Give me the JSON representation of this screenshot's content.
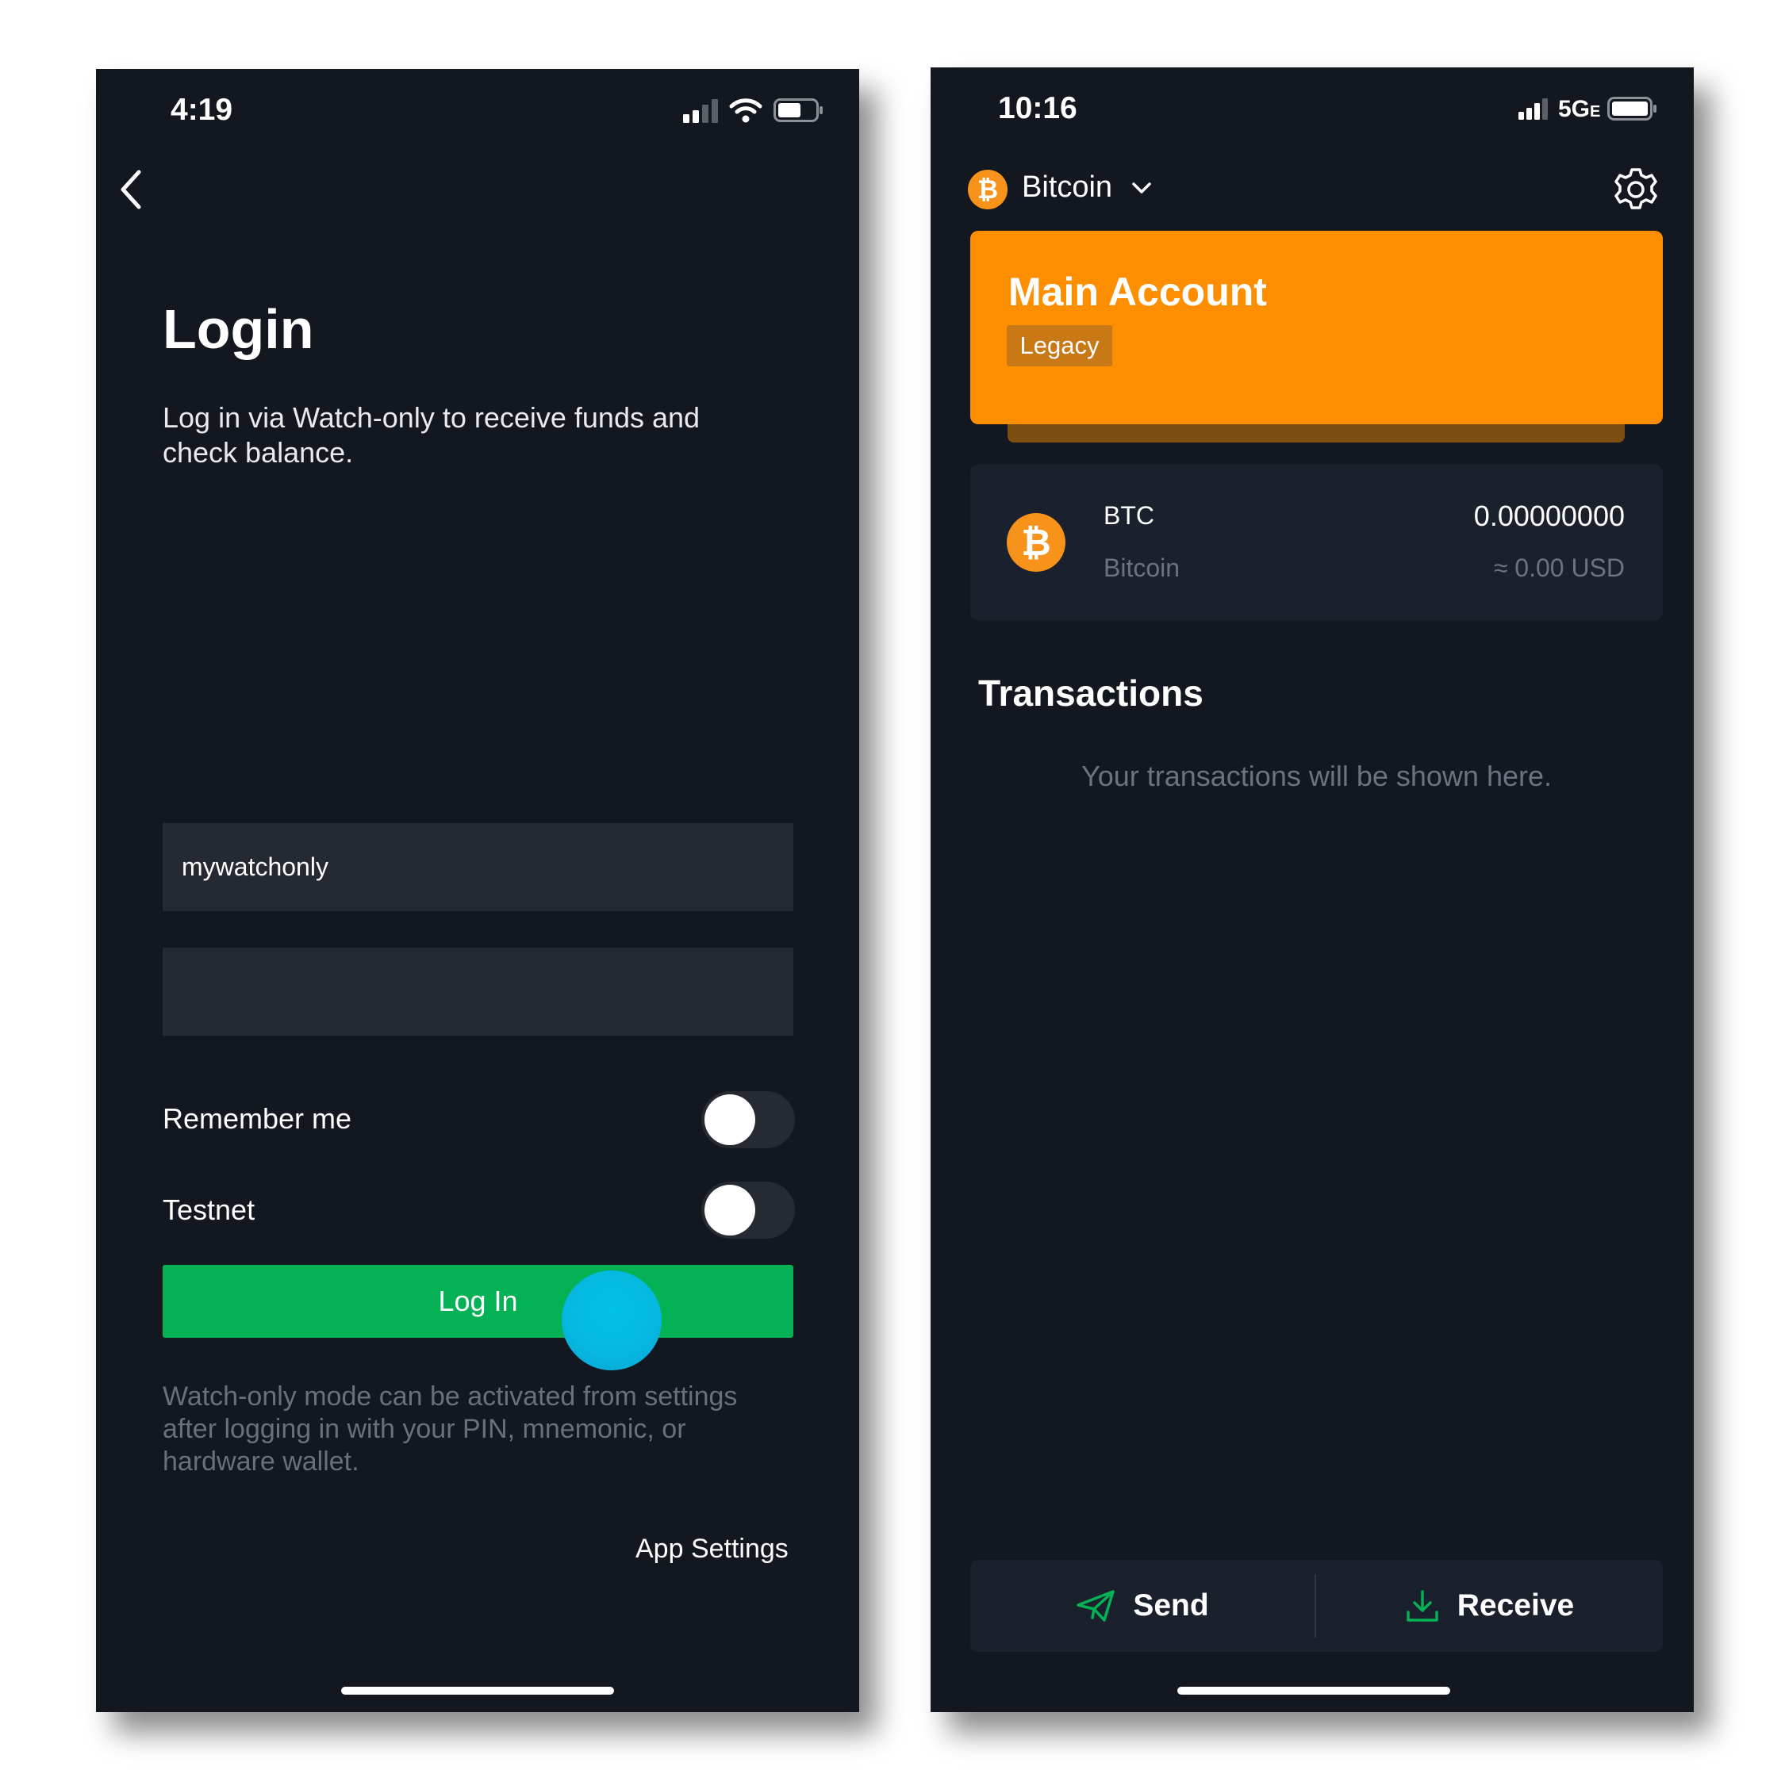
{
  "left_screen": {
    "status_bar": {
      "time": "4:19"
    },
    "title": "Login",
    "subtitle": "Log in via Watch-only to receive funds and check balance.",
    "username_input": {
      "value": "mywatchonly",
      "placeholder": ""
    },
    "second_input": {
      "value": "",
      "placeholder": ""
    },
    "toggles": [
      {
        "label": "Remember me",
        "on": false
      },
      {
        "label": "Testnet",
        "on": false
      }
    ],
    "login_button_label": "Log In",
    "hint": "Watch-only mode can be activated from settings after logging in with your PIN, mnemonic, or hardware wallet.",
    "app_settings_label": "App Settings"
  },
  "right_screen": {
    "status_bar": {
      "time": "10:16",
      "network": "5G",
      "network_suffix": "E"
    },
    "coin_selector": {
      "name": "Bitcoin",
      "icon": "bitcoin-icon"
    },
    "account_card": {
      "title": "Main Account",
      "badge": "Legacy",
      "color": "#fd8e00"
    },
    "asset": {
      "symbol": "BTC",
      "name": "Bitcoin",
      "balance": "0.00000000",
      "fiat": "≈ 0.00 USD"
    },
    "transactions": {
      "title": "Transactions",
      "empty": "Your transactions will be shown here."
    },
    "actions": {
      "send_label": "Send",
      "receive_label": "Receive",
      "accent": "#05b155"
    }
  }
}
